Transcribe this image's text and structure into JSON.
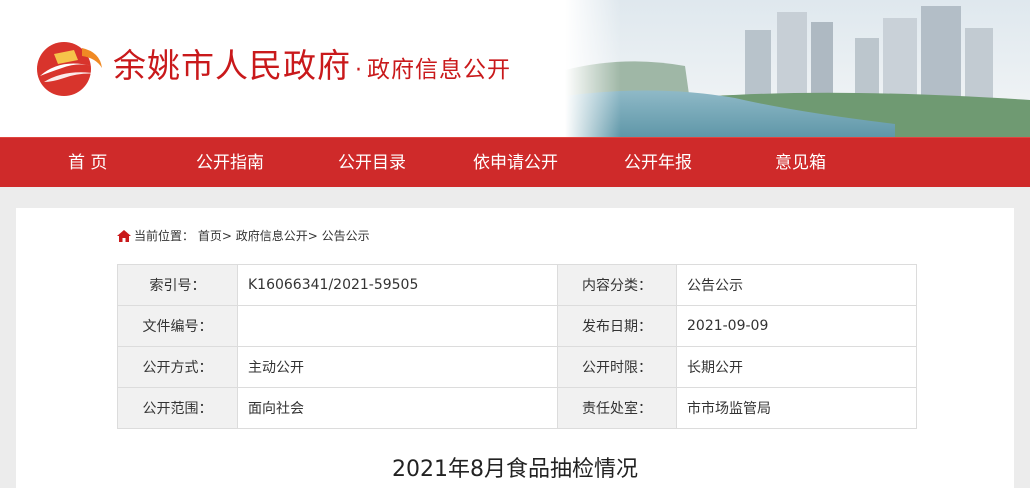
{
  "header": {
    "site_name": "余姚市人民政府",
    "separator": "·",
    "section_name": "政府信息公开",
    "logo_icon": "government-logo-icon",
    "banner_icon": "city-skyline-banner-image"
  },
  "nav": {
    "items": [
      {
        "label": "首 页"
      },
      {
        "label": "公开指南"
      },
      {
        "label": "公开目录"
      },
      {
        "label": "依申请公开"
      },
      {
        "label": "公开年报"
      },
      {
        "label": "意见箱"
      }
    ]
  },
  "breadcrumb": {
    "prefix": "当前位置：",
    "items": [
      "首页",
      "政府信息公开",
      "公告公示"
    ],
    "separator": ">"
  },
  "meta": {
    "index_label": "索引号：",
    "index_value": "K16066341/2021-59505",
    "category_label": "内容分类：",
    "category_value": "公告公示",
    "doc_no_label": "文件编号：",
    "doc_no_value": "",
    "pub_date_label": "发布日期：",
    "pub_date_value": "2021-09-09",
    "method_label": "公开方式：",
    "method_value": "主动公开",
    "period_label": "公开时限：",
    "period_value": "长期公开",
    "scope_label": "公开范围：",
    "scope_value": "面向社会",
    "dept_label": "责任处室：",
    "dept_value": "市市场监管局"
  },
  "article": {
    "title": "2021年8月食品抽检情况"
  },
  "colors": {
    "brand_red": "#cf2a2a",
    "title_red": "#c9191b",
    "label_bg": "#f1f1f1",
    "page_bg": "#ececec"
  }
}
